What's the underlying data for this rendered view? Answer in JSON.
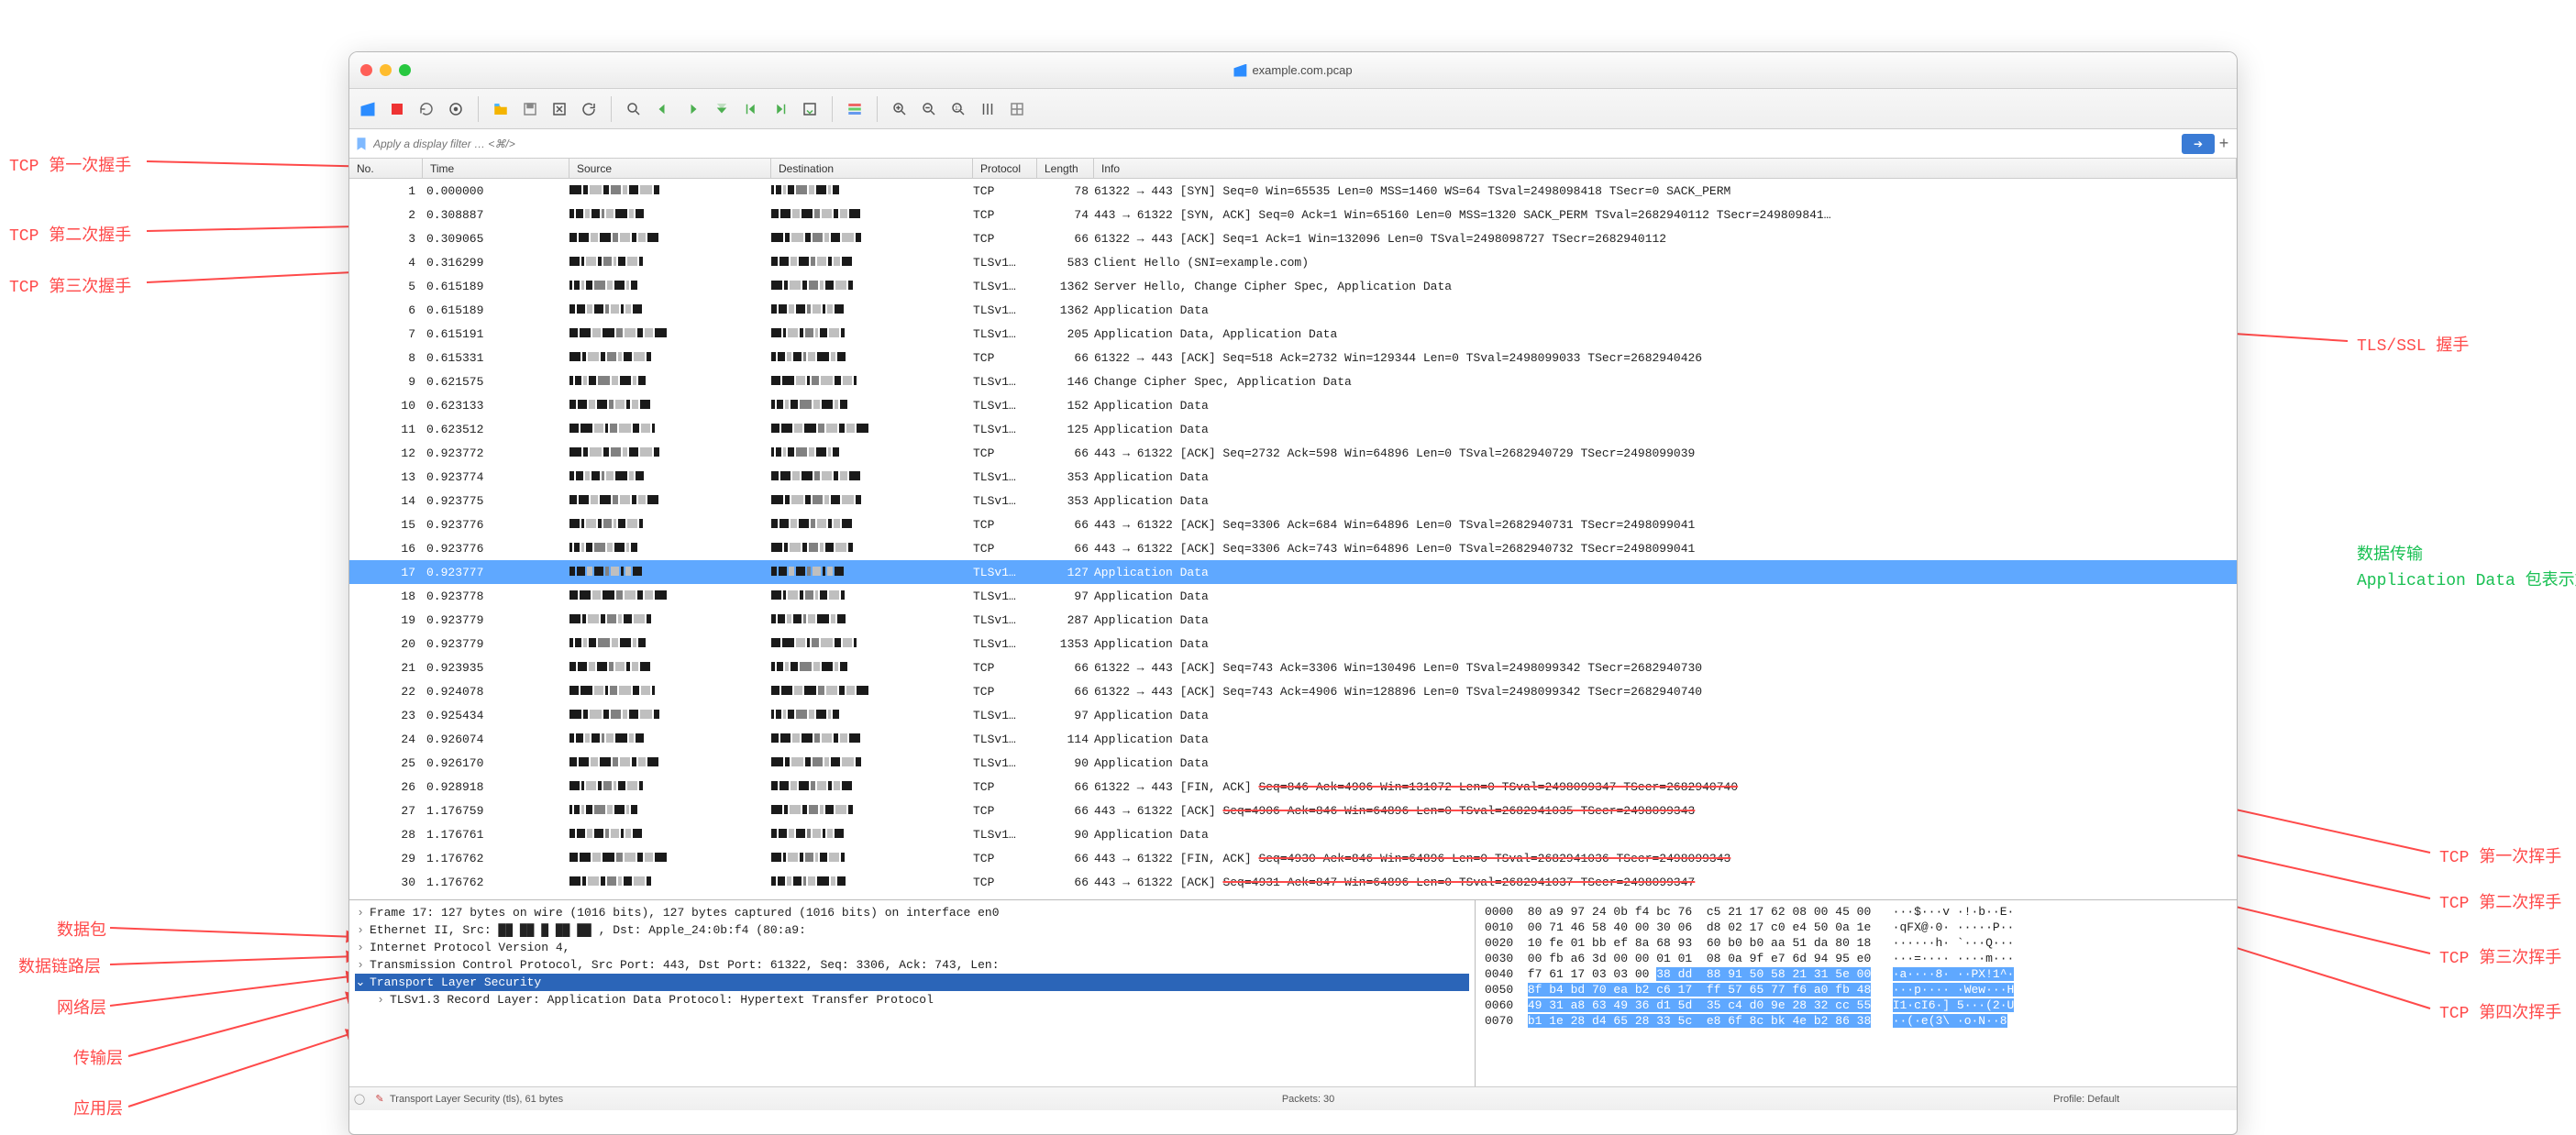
{
  "window_title": "example.com.pcap",
  "filter_placeholder": "Apply a display filter … <⌘/>",
  "columns": [
    "No.",
    "Time",
    "Source",
    "Destination",
    "Protocol",
    "Length",
    "Info"
  ],
  "selected_row": 17,
  "packets": [
    {
      "no": 1,
      "time": "0.000000",
      "proto": "TCP",
      "len": 78,
      "info": "61322 → 443 [SYN] Seq=0 Win=65535 Len=0 MSS=1460 WS=64 TSval=2498098418 TSecr=0 SACK_PERM"
    },
    {
      "no": 2,
      "time": "0.308887",
      "proto": "TCP",
      "len": 74,
      "info": "443 → 61322 [SYN, ACK] Seq=0 Ack=1 Win=65160 Len=0 MSS=1320 SACK_PERM TSval=2682940112 TSecr=249809841…"
    },
    {
      "no": 3,
      "time": "0.309065",
      "proto": "TCP",
      "len": 66,
      "info": "61322 → 443 [ACK] Seq=1 Ack=1 Win=132096 Len=0 TSval=2498098727 TSecr=2682940112"
    },
    {
      "no": 4,
      "time": "0.316299",
      "proto": "TLSv1…",
      "len": 583,
      "info": "Client Hello (SNI=example.com)"
    },
    {
      "no": 5,
      "time": "0.615189",
      "proto": "TLSv1…",
      "len": 1362,
      "info": "Server Hello, Change Cipher Spec, Application Data"
    },
    {
      "no": 6,
      "time": "0.615189",
      "proto": "TLSv1…",
      "len": 1362,
      "info": "Application Data"
    },
    {
      "no": 7,
      "time": "0.615191",
      "proto": "TLSv1…",
      "len": 205,
      "info": "Application Data, Application Data"
    },
    {
      "no": 8,
      "time": "0.615331",
      "proto": "TCP",
      "len": 66,
      "info": "61322 → 443 [ACK] Seq=518 Ack=2732 Win=129344 Len=0 TSval=2498099033 TSecr=2682940426"
    },
    {
      "no": 9,
      "time": "0.621575",
      "proto": "TLSv1…",
      "len": 146,
      "info": "Change Cipher Spec, Application Data"
    },
    {
      "no": 10,
      "time": "0.623133",
      "proto": "TLSv1…",
      "len": 152,
      "info": "Application Data"
    },
    {
      "no": 11,
      "time": "0.623512",
      "proto": "TLSv1…",
      "len": 125,
      "info": "Application Data"
    },
    {
      "no": 12,
      "time": "0.923772",
      "proto": "TCP",
      "len": 66,
      "info": "443 → 61322 [ACK] Seq=2732 Ack=598 Win=64896 Len=0 TSval=2682940729 TSecr=2498099039"
    },
    {
      "no": 13,
      "time": "0.923774",
      "proto": "TLSv1…",
      "len": 353,
      "info": "Application Data"
    },
    {
      "no": 14,
      "time": "0.923775",
      "proto": "TLSv1…",
      "len": 353,
      "info": "Application Data"
    },
    {
      "no": 15,
      "time": "0.923776",
      "proto": "TCP",
      "len": 66,
      "info": "443 → 61322 [ACK] Seq=3306 Ack=684 Win=64896 Len=0 TSval=2682940731 TSecr=2498099041"
    },
    {
      "no": 16,
      "time": "0.923776",
      "proto": "TCP",
      "len": 66,
      "info": "443 → 61322 [ACK] Seq=3306 Ack=743 Win=64896 Len=0 TSval=2682940732 TSecr=2498099041"
    },
    {
      "no": 17,
      "time": "0.923777",
      "proto": "TLSv1…",
      "len": 127,
      "info": "Application Data"
    },
    {
      "no": 18,
      "time": "0.923778",
      "proto": "TLSv1…",
      "len": 97,
      "info": "Application Data"
    },
    {
      "no": 19,
      "time": "0.923779",
      "proto": "TLSv1…",
      "len": 287,
      "info": "Application Data"
    },
    {
      "no": 20,
      "time": "0.923779",
      "proto": "TLSv1…",
      "len": 1353,
      "info": "Application Data"
    },
    {
      "no": 21,
      "time": "0.923935",
      "proto": "TCP",
      "len": 66,
      "info": "61322 → 443 [ACK] Seq=743 Ack=3306 Win=130496 Len=0 TSval=2498099342 TSecr=2682940730"
    },
    {
      "no": 22,
      "time": "0.924078",
      "proto": "TCP",
      "len": 66,
      "info": "61322 → 443 [ACK] Seq=743 Ack=4906 Win=128896 Len=0 TSval=2498099342 TSecr=2682940740"
    },
    {
      "no": 23,
      "time": "0.925434",
      "proto": "TLSv1…",
      "len": 97,
      "info": "Application Data"
    },
    {
      "no": 24,
      "time": "0.926074",
      "proto": "TLSv1…",
      "len": 114,
      "info": "Application Data"
    },
    {
      "no": 25,
      "time": "0.926170",
      "proto": "TLSv1…",
      "len": 90,
      "info": "Application Data"
    },
    {
      "no": 26,
      "time": "0.928918",
      "proto": "TCP",
      "len": 66,
      "info": "61322 → 443 [FIN, ACK] Seq=846 Ack=4906 Win=131072 Len=0 TSval=2498099347 TSecr=2682940740"
    },
    {
      "no": 27,
      "time": "1.176759",
      "proto": "TCP",
      "len": 66,
      "info": "443 → 61322 [ACK] Seq=4906 Ack=846 Win=64896 Len=0 TSval=2682941035 TSecr=2498099343"
    },
    {
      "no": 28,
      "time": "1.176761",
      "proto": "TLSv1…",
      "len": 90,
      "info": "Application Data"
    },
    {
      "no": 29,
      "time": "1.176762",
      "proto": "TCP",
      "len": 66,
      "info": "443 → 61322 [FIN, ACK] Seq=4930 Ack=846 Win=64896 Len=0 TSval=2682941036 TSecr=2498099343"
    },
    {
      "no": 30,
      "time": "1.176762",
      "proto": "TCP",
      "len": 66,
      "info": "443 → 61322 [ACK] Seq=4931 Ack=847 Win=64896 Len=0 TSval=2682941037 TSecr=2498099347"
    }
  ],
  "tree": [
    {
      "label": "Frame 17: 127 bytes on wire (1016 bits), 127 bytes captured (1016 bits) on interface en0",
      "expand": ">"
    },
    {
      "label": "Ethernet II, Src: ██ ██ █ ██ ██  , Dst: Apple_24:0b:f4 (80:a9:",
      "expand": ">"
    },
    {
      "label": "Internet Protocol Version 4, ",
      "expand": ">"
    },
    {
      "label": "Transmission Control Protocol, Src Port: 443, Dst Port: 61322, Seq: 3306, Ack: 743, Len:",
      "expand": ">"
    },
    {
      "label": "Transport Layer Security",
      "expand": "v",
      "selected": true
    },
    {
      "label": "TLSv1.3 Record Layer: Application Data Protocol: Hypertext Transfer Protocol",
      "expand": ">",
      "indent": true
    }
  ],
  "hex": [
    {
      "off": "0000",
      "b": "80 a9 97 24 0b f4 bc 76  c5 21 17 62 08 00 45 00",
      "a": "···$···v ·!·b··E·"
    },
    {
      "off": "0010",
      "b": "00 71 46 58 40 00 30 06  d8 02 17 c0 e4 50 0a 1e",
      "a": "·qFX@·0· ·····P··"
    },
    {
      "off": "0020",
      "b": "10 fe 01 bb ef 8a 68 93  60 b0 b0 aa 51 da 80 18",
      "a": "······h· `···Q···"
    },
    {
      "off": "0030",
      "b": "00 fb a6 3d 00 00 01 01  08 0a 9f e7 6d 94 95 e0",
      "a": "···=···· ····m···"
    },
    {
      "off": "0040",
      "b": "f7 61 17 03 03 00 38 dd  88 91 50 58 21 31 5e 00",
      "a": "·a····8· ··PX!1^·",
      "hl": [
        6,
        99
      ]
    },
    {
      "off": "0050",
      "b": "8f b4 bd 70 ea b2 c6 17  ff 57 65 77 f6 a0 fb 48",
      "a": "···p···· ·Wew···H",
      "hl": [
        0,
        99
      ]
    },
    {
      "off": "0060",
      "b": "49 31 a8 63 49 36 d1 5d  35 c4 d0 9e 28 32 cc 55",
      "a": "I1·cI6·] 5···(2·U",
      "hl": [
        0,
        99
      ]
    },
    {
      "off": "0070",
      "b": "b1 1e 28 d4 65 28 33 5c  e8 6f 8c bk 4e b2 86 38",
      "a": "··(·e(3\\ ·o·N··8",
      "hl": [
        0,
        99
      ]
    }
  ],
  "status": {
    "left": "Transport Layer Security (tls), 61 bytes",
    "mid": "Packets: 30",
    "right": "Profile: Default"
  },
  "annotations": {
    "tcp1": "TCP 第一次握手",
    "tcp2": "TCP 第二次握手",
    "tcp3": "TCP 第三次握手",
    "tls": "TLS/SSL 握手",
    "data1": "数据传输",
    "data2": "Application Data 包表示加密的应用层数据交换",
    "fin1": "TCP 第一次挥手",
    "fin2": "TCP 第二次挥手",
    "fin3": "TCP 第三次挥手",
    "fin4": "TCP 第四次挥手",
    "l_packet": "数据包",
    "l_eth": "数据链路层",
    "l_ip": "网络层",
    "l_tcp": "传输层",
    "l_app": "应用层"
  }
}
